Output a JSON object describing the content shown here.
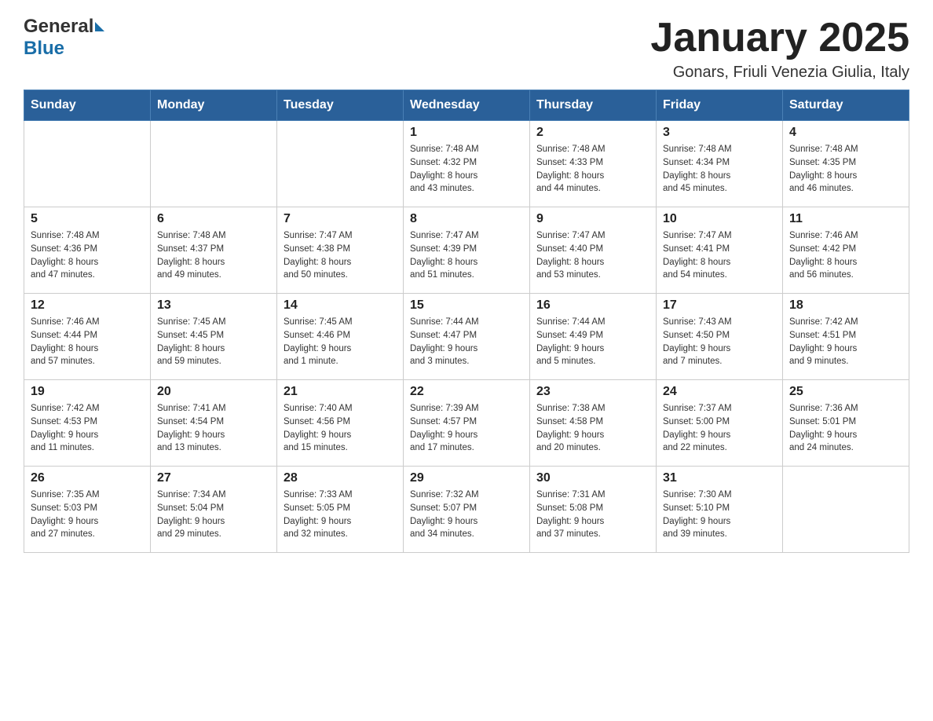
{
  "header": {
    "logo_general": "General",
    "logo_blue": "Blue",
    "month_title": "January 2025",
    "location": "Gonars, Friuli Venezia Giulia, Italy"
  },
  "days_of_week": [
    "Sunday",
    "Monday",
    "Tuesday",
    "Wednesday",
    "Thursday",
    "Friday",
    "Saturday"
  ],
  "weeks": [
    {
      "cells": [
        {
          "day": "",
          "info": ""
        },
        {
          "day": "",
          "info": ""
        },
        {
          "day": "",
          "info": ""
        },
        {
          "day": "1",
          "info": "Sunrise: 7:48 AM\nSunset: 4:32 PM\nDaylight: 8 hours\nand 43 minutes."
        },
        {
          "day": "2",
          "info": "Sunrise: 7:48 AM\nSunset: 4:33 PM\nDaylight: 8 hours\nand 44 minutes."
        },
        {
          "day": "3",
          "info": "Sunrise: 7:48 AM\nSunset: 4:34 PM\nDaylight: 8 hours\nand 45 minutes."
        },
        {
          "day": "4",
          "info": "Sunrise: 7:48 AM\nSunset: 4:35 PM\nDaylight: 8 hours\nand 46 minutes."
        }
      ]
    },
    {
      "cells": [
        {
          "day": "5",
          "info": "Sunrise: 7:48 AM\nSunset: 4:36 PM\nDaylight: 8 hours\nand 47 minutes."
        },
        {
          "day": "6",
          "info": "Sunrise: 7:48 AM\nSunset: 4:37 PM\nDaylight: 8 hours\nand 49 minutes."
        },
        {
          "day": "7",
          "info": "Sunrise: 7:47 AM\nSunset: 4:38 PM\nDaylight: 8 hours\nand 50 minutes."
        },
        {
          "day": "8",
          "info": "Sunrise: 7:47 AM\nSunset: 4:39 PM\nDaylight: 8 hours\nand 51 minutes."
        },
        {
          "day": "9",
          "info": "Sunrise: 7:47 AM\nSunset: 4:40 PM\nDaylight: 8 hours\nand 53 minutes."
        },
        {
          "day": "10",
          "info": "Sunrise: 7:47 AM\nSunset: 4:41 PM\nDaylight: 8 hours\nand 54 minutes."
        },
        {
          "day": "11",
          "info": "Sunrise: 7:46 AM\nSunset: 4:42 PM\nDaylight: 8 hours\nand 56 minutes."
        }
      ]
    },
    {
      "cells": [
        {
          "day": "12",
          "info": "Sunrise: 7:46 AM\nSunset: 4:44 PM\nDaylight: 8 hours\nand 57 minutes."
        },
        {
          "day": "13",
          "info": "Sunrise: 7:45 AM\nSunset: 4:45 PM\nDaylight: 8 hours\nand 59 minutes."
        },
        {
          "day": "14",
          "info": "Sunrise: 7:45 AM\nSunset: 4:46 PM\nDaylight: 9 hours\nand 1 minute."
        },
        {
          "day": "15",
          "info": "Sunrise: 7:44 AM\nSunset: 4:47 PM\nDaylight: 9 hours\nand 3 minutes."
        },
        {
          "day": "16",
          "info": "Sunrise: 7:44 AM\nSunset: 4:49 PM\nDaylight: 9 hours\nand 5 minutes."
        },
        {
          "day": "17",
          "info": "Sunrise: 7:43 AM\nSunset: 4:50 PM\nDaylight: 9 hours\nand 7 minutes."
        },
        {
          "day": "18",
          "info": "Sunrise: 7:42 AM\nSunset: 4:51 PM\nDaylight: 9 hours\nand 9 minutes."
        }
      ]
    },
    {
      "cells": [
        {
          "day": "19",
          "info": "Sunrise: 7:42 AM\nSunset: 4:53 PM\nDaylight: 9 hours\nand 11 minutes."
        },
        {
          "day": "20",
          "info": "Sunrise: 7:41 AM\nSunset: 4:54 PM\nDaylight: 9 hours\nand 13 minutes."
        },
        {
          "day": "21",
          "info": "Sunrise: 7:40 AM\nSunset: 4:56 PM\nDaylight: 9 hours\nand 15 minutes."
        },
        {
          "day": "22",
          "info": "Sunrise: 7:39 AM\nSunset: 4:57 PM\nDaylight: 9 hours\nand 17 minutes."
        },
        {
          "day": "23",
          "info": "Sunrise: 7:38 AM\nSunset: 4:58 PM\nDaylight: 9 hours\nand 20 minutes."
        },
        {
          "day": "24",
          "info": "Sunrise: 7:37 AM\nSunset: 5:00 PM\nDaylight: 9 hours\nand 22 minutes."
        },
        {
          "day": "25",
          "info": "Sunrise: 7:36 AM\nSunset: 5:01 PM\nDaylight: 9 hours\nand 24 minutes."
        }
      ]
    },
    {
      "cells": [
        {
          "day": "26",
          "info": "Sunrise: 7:35 AM\nSunset: 5:03 PM\nDaylight: 9 hours\nand 27 minutes."
        },
        {
          "day": "27",
          "info": "Sunrise: 7:34 AM\nSunset: 5:04 PM\nDaylight: 9 hours\nand 29 minutes."
        },
        {
          "day": "28",
          "info": "Sunrise: 7:33 AM\nSunset: 5:05 PM\nDaylight: 9 hours\nand 32 minutes."
        },
        {
          "day": "29",
          "info": "Sunrise: 7:32 AM\nSunset: 5:07 PM\nDaylight: 9 hours\nand 34 minutes."
        },
        {
          "day": "30",
          "info": "Sunrise: 7:31 AM\nSunset: 5:08 PM\nDaylight: 9 hours\nand 37 minutes."
        },
        {
          "day": "31",
          "info": "Sunrise: 7:30 AM\nSunset: 5:10 PM\nDaylight: 9 hours\nand 39 minutes."
        },
        {
          "day": "",
          "info": ""
        }
      ]
    }
  ]
}
